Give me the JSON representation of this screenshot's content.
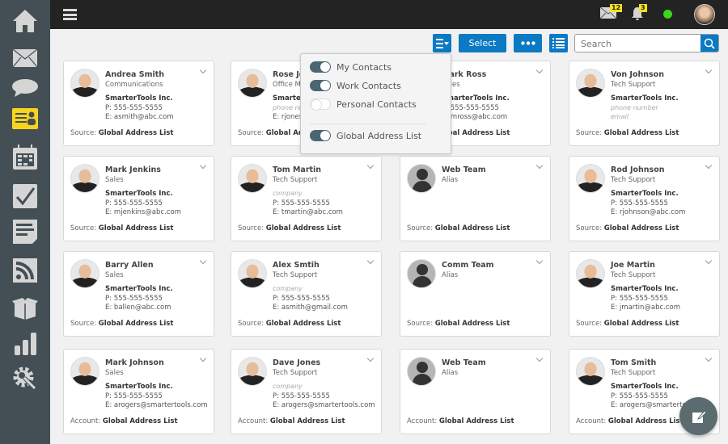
{
  "sidebar": {
    "items": [
      {
        "name": "home-icon"
      },
      {
        "name": "mail-icon"
      },
      {
        "name": "chat-icon"
      },
      {
        "name": "contacts-icon",
        "active": true
      },
      {
        "name": "calendar-icon"
      },
      {
        "name": "tasks-icon"
      },
      {
        "name": "notes-icon"
      },
      {
        "name": "rss-icon"
      },
      {
        "name": "file-storage-icon"
      },
      {
        "name": "reports-icon"
      },
      {
        "name": "settings-icon"
      }
    ],
    "active_color": "#f7d51d",
    "icon_color": "#d5d5d5"
  },
  "topbar": {
    "mail_count": "12",
    "notification_count": "3",
    "status_color": "#3bd61a"
  },
  "toolbar": {
    "select_label": "Select",
    "search_placeholder": "Search",
    "accent": "#0b79c3"
  },
  "dropdown": {
    "items": [
      {
        "label": "My Contacts",
        "on": true
      },
      {
        "label": "Work Contacts",
        "on": true
      },
      {
        "label": "Personal Contacts",
        "on": false
      },
      {
        "label": "Global Address List",
        "on": true
      }
    ]
  },
  "cards": [
    {
      "name": "Andrea Smith",
      "title": "Communications",
      "company": "SmarterTools Inc.",
      "phone": "P: 555-555-5555",
      "email": "E: asmith@abc.com",
      "footer_label": "Source:",
      "footer_value": "Global Address List",
      "avatar": "photo"
    },
    {
      "name": "Rose Jones",
      "title": "Office Manager",
      "company": "SmarterTools Inc.",
      "phone": "phone number",
      "phone_placeholder": true,
      "email": "E: rjones@abc.com",
      "footer_label": "Source:",
      "footer_value": "Global Address List",
      "avatar": "photo"
    },
    {
      "name": "Mark Ross",
      "title": "Sales",
      "company": "SmarterTools Inc.",
      "phone": "P: 555-555-5555",
      "email": "E: mross@abc.com",
      "footer_label": "Source:",
      "footer_value": "Global Address List",
      "avatar": "photo"
    },
    {
      "name": "Von Johnson",
      "title": "Tech Support",
      "company": "SmarterTools Inc.",
      "phone": "phone number",
      "phone_placeholder": true,
      "email": "email",
      "email_placeholder": true,
      "footer_label": "Source:",
      "footer_value": "Global Address List",
      "avatar": "photo"
    },
    {
      "name": "Mark Jenkins",
      "title": "Sales",
      "company": "SmarterTools Inc.",
      "phone": "P: 555-555-5555",
      "email": "E: mjenkins@abc.com",
      "footer_label": "Source:",
      "footer_value": "Global Address List",
      "avatar": "photo"
    },
    {
      "name": "Tom Martin",
      "title": "Tech Support",
      "company": "company",
      "company_placeholder": true,
      "phone": "P: 555-555-5555",
      "email": "E: tmartin@abc.com",
      "footer_label": "Source:",
      "footer_value": "Global Address List",
      "avatar": "photo"
    },
    {
      "name": "Web Team",
      "title": "Alias",
      "footer_label": "Source:",
      "footer_value": "Global Address List",
      "avatar": "alias"
    },
    {
      "name": "Rod Johnson",
      "title": "Tech Support",
      "company": "SmarterTools Inc.",
      "phone": "P: 555-555-5555",
      "email": "E: rjohnson@abc.com",
      "footer_label": "Source:",
      "footer_value": "Global Address List",
      "avatar": "photo"
    },
    {
      "name": "Barry Allen",
      "title": "Sales",
      "company": "SmarterTools Inc.",
      "phone": "P: 555-555-5555",
      "email": "E: ballen@abc.com",
      "footer_label": "Source:",
      "footer_value": "Global Address List",
      "avatar": "photo"
    },
    {
      "name": "Alex Smtih",
      "title": "Tech Support",
      "company": "company",
      "company_placeholder": true,
      "phone": "P: 555-555-5555",
      "email": "E: asmith@gmail.com",
      "footer_label": "Source:",
      "footer_value": "Global Address List",
      "avatar": "photo"
    },
    {
      "name": "Comm Team",
      "title": "Alias",
      "footer_label": "Source:",
      "footer_value": "Global Address List",
      "avatar": "alias"
    },
    {
      "name": "Joe Martin",
      "title": "Tech Support",
      "company": "SmarterTools Inc.",
      "phone": "P: 555-555-5555",
      "email": "E: jmartin@abc.com",
      "footer_label": "Source:",
      "footer_value": "Global Address List",
      "avatar": "photo"
    },
    {
      "name": "Mark Johnson",
      "title": "Sales",
      "company": "SmarterTools Inc.",
      "phone": "P: 555-555-5555",
      "email": "E: arogers@smartertools.com",
      "footer_label": "Account:",
      "footer_value": "Global Address List",
      "avatar": "photo"
    },
    {
      "name": "Dave Jones",
      "title": "Tech Support",
      "company": "company",
      "company_placeholder": true,
      "phone": "P: 555-555-5555",
      "email": "E: arogers@smartertools.com",
      "footer_label": "Account:",
      "footer_value": "Global Address List",
      "avatar": "photo"
    },
    {
      "name": "Web Team",
      "title": "Alias",
      "footer_label": "Account:",
      "footer_value": "Global Address List",
      "avatar": "alias"
    },
    {
      "name": "Tom Smith",
      "title": "Tech Support",
      "company": "SmarterTools Inc.",
      "phone": "P: 555-555-5555",
      "email": "E: arogers@smartertools.com",
      "footer_label": "Account:",
      "footer_value": "Global Address List",
      "avatar": "photo"
    }
  ]
}
